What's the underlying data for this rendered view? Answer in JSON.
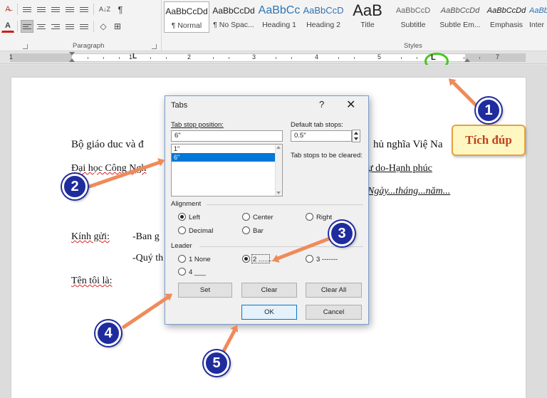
{
  "ribbon": {
    "paragraph_label": "Paragraph",
    "styles_label": "Styles",
    "styles": [
      {
        "sample": "AaBbCcDd",
        "name": "¶ Normal"
      },
      {
        "sample": "AaBbCcDd",
        "name": "¶ No Spac..."
      },
      {
        "sample": "AaBbCc",
        "name": "Heading 1"
      },
      {
        "sample": "AaBbCcD",
        "name": "Heading 2"
      },
      {
        "sample": "AaB",
        "name": "Title"
      },
      {
        "sample": "AaBbCcD",
        "name": "Subtitle"
      },
      {
        "sample": "AaBbCcDd",
        "name": "Subtle Em..."
      },
      {
        "sample": "AaBbCcDd",
        "name": "Emphasis"
      },
      {
        "sample": "AaBbCcDd",
        "name": "Inter"
      }
    ],
    "pilcrow": "¶",
    "font_color_letter": "A",
    "sort_glyph": "A↓Z"
  },
  "ruler": {
    "numbers": [
      "1",
      "1",
      "2",
      "3",
      "4",
      "5",
      "6",
      "7"
    ],
    "tab_marker": "L"
  },
  "document": {
    "line1": "Bộ giáo duc và đ",
    "line1_right": "hủ nghĩa Việ Na",
    "line2": "Đại học Công Ngh",
    "line2_right": "ự do-Hạnh phúc",
    "line3_right": "Ngày...tháng...năm...",
    "line4_label": "Kính gửi:",
    "line4_value": "-Ban g",
    "line5_value": "-Quý th",
    "line6": "Tên tôi là:"
  },
  "dialog": {
    "title": "Tabs",
    "help": "?",
    "close": "✕",
    "tab_stop_label": "Tab stop position:",
    "tab_stop_value": "6\"",
    "tab_list": [
      "1\"",
      "6\""
    ],
    "default_tab_label": "Default tab stops:",
    "default_tab_value": "0.5\"",
    "cleared_label": "Tab stops to be cleared:",
    "alignment_label": "Alignment",
    "alignment": [
      {
        "label": "Left",
        "checked": true
      },
      {
        "label": "Center",
        "checked": false
      },
      {
        "label": "Right",
        "checked": false
      },
      {
        "label": "Decimal",
        "checked": false
      },
      {
        "label": "Bar",
        "checked": false
      }
    ],
    "leader_label": "Leader",
    "leader": [
      {
        "label": "1 None",
        "checked": false
      },
      {
        "label": "2 ........",
        "checked": true
      },
      {
        "label": "3 -------",
        "checked": false
      },
      {
        "label": "4 ___",
        "checked": false
      }
    ],
    "buttons": {
      "set": "Set",
      "clear": "Clear",
      "clear_all": "Clear All",
      "ok": "OK",
      "cancel": "Cancel"
    }
  },
  "callouts": {
    "badges": [
      "1",
      "2",
      "3",
      "4",
      "5"
    ],
    "tip": "Tích đúp",
    "arrow_color": "#ef8b5a",
    "badge_color": "#1f2c9e",
    "highlight_color": "#43c81b"
  }
}
